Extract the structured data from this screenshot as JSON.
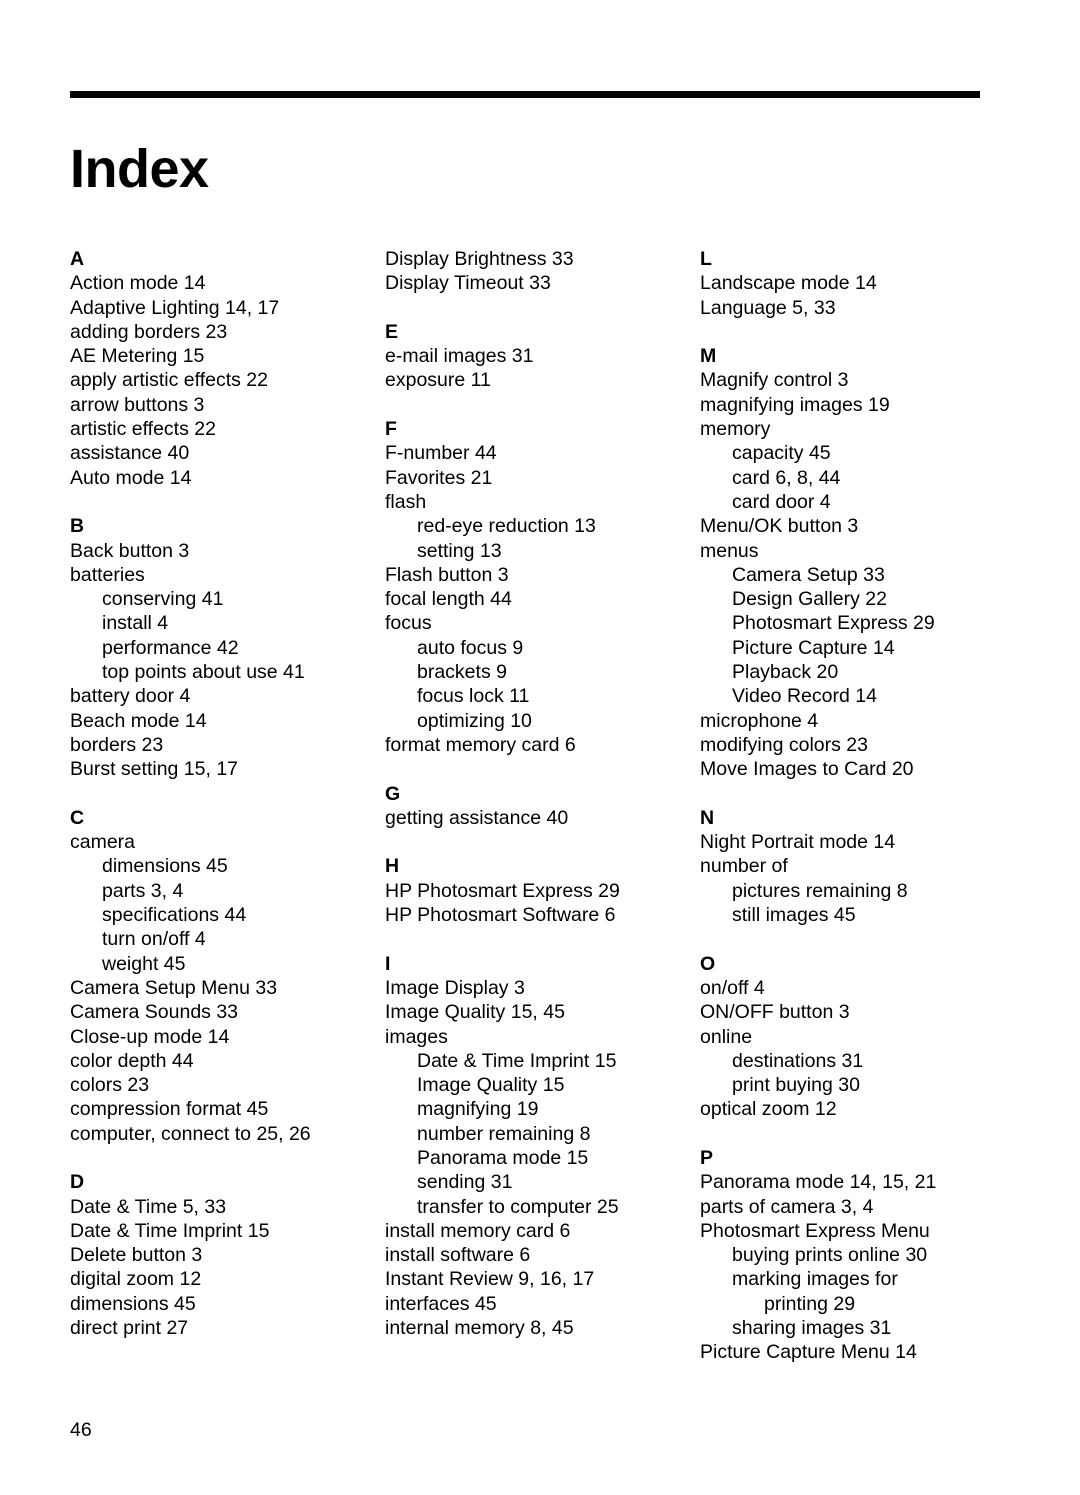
{
  "document": {
    "title": "Index",
    "page_number": "46"
  },
  "columns": [
    {
      "sections": [
        {
          "letter": "A",
          "entries": [
            {
              "text": "Action mode 14",
              "level": 0
            },
            {
              "text": "Adaptive Lighting 14, 17",
              "level": 0
            },
            {
              "text": "adding borders 23",
              "level": 0
            },
            {
              "text": "AE Metering 15",
              "level": 0
            },
            {
              "text": "apply artistic effects 22",
              "level": 0
            },
            {
              "text": "arrow buttons 3",
              "level": 0
            },
            {
              "text": "artistic effects 22",
              "level": 0
            },
            {
              "text": "assistance 40",
              "level": 0
            },
            {
              "text": "Auto mode 14",
              "level": 0
            }
          ]
        },
        {
          "letter": "B",
          "entries": [
            {
              "text": "Back button 3",
              "level": 0
            },
            {
              "text": "batteries",
              "level": 0
            },
            {
              "text": "conserving 41",
              "level": 1
            },
            {
              "text": "install 4",
              "level": 1
            },
            {
              "text": "performance 42",
              "level": 1
            },
            {
              "text": "top points about use 41",
              "level": 1
            },
            {
              "text": "battery door 4",
              "level": 0
            },
            {
              "text": "Beach mode 14",
              "level": 0
            },
            {
              "text": "borders 23",
              "level": 0
            },
            {
              "text": "Burst setting 15, 17",
              "level": 0
            }
          ]
        },
        {
          "letter": "C",
          "entries": [
            {
              "text": "camera",
              "level": 0
            },
            {
              "text": "dimensions 45",
              "level": 1
            },
            {
              "text": "parts 3, 4",
              "level": 1
            },
            {
              "text": "specifications 44",
              "level": 1
            },
            {
              "text": "turn on/off 4",
              "level": 1
            },
            {
              "text": "weight 45",
              "level": 1
            },
            {
              "text": "Camera Setup Menu 33",
              "level": 0
            },
            {
              "text": "Camera Sounds 33",
              "level": 0
            },
            {
              "text": "Close-up mode 14",
              "level": 0
            },
            {
              "text": "color depth 44",
              "level": 0
            },
            {
              "text": "colors 23",
              "level": 0
            },
            {
              "text": "compression format 45",
              "level": 0
            },
            {
              "text": "computer, connect to 25, 26",
              "level": 0
            }
          ]
        },
        {
          "letter": "D",
          "entries": [
            {
              "text": "Date & Time 5, 33",
              "level": 0
            },
            {
              "text": "Date & Time Imprint 15",
              "level": 0
            },
            {
              "text": "Delete button 3",
              "level": 0
            },
            {
              "text": "digital zoom 12",
              "level": 0
            },
            {
              "text": "dimensions 45",
              "level": 0
            },
            {
              "text": "direct print 27",
              "level": 0
            }
          ]
        }
      ]
    },
    {
      "sections": [
        {
          "letter": "",
          "entries": [
            {
              "text": "Display Brightness 33",
              "level": 0
            },
            {
              "text": "Display Timeout 33",
              "level": 0
            }
          ]
        },
        {
          "letter": "E",
          "entries": [
            {
              "text": "e-mail images 31",
              "level": 0
            },
            {
              "text": "exposure 11",
              "level": 0
            }
          ]
        },
        {
          "letter": "F",
          "entries": [
            {
              "text": "F-number 44",
              "level": 0
            },
            {
              "text": "Favorites 21",
              "level": 0
            },
            {
              "text": "flash",
              "level": 0
            },
            {
              "text": "red-eye reduction 13",
              "level": 1
            },
            {
              "text": "setting 13",
              "level": 1
            },
            {
              "text": "Flash button 3",
              "level": 0
            },
            {
              "text": "focal length 44",
              "level": 0
            },
            {
              "text": "focus",
              "level": 0
            },
            {
              "text": "auto focus 9",
              "level": 1
            },
            {
              "text": "brackets 9",
              "level": 1
            },
            {
              "text": "focus lock 11",
              "level": 1
            },
            {
              "text": "optimizing 10",
              "level": 1
            },
            {
              "text": "format memory card 6",
              "level": 0
            }
          ]
        },
        {
          "letter": "G",
          "entries": [
            {
              "text": "getting assistance 40",
              "level": 0
            }
          ]
        },
        {
          "letter": "H",
          "entries": [
            {
              "text": "HP Photosmart Express 29",
              "level": 0
            },
            {
              "text": "HP Photosmart Software 6",
              "level": 0
            }
          ]
        },
        {
          "letter": "I",
          "entries": [
            {
              "text": "Image Display 3",
              "level": 0
            },
            {
              "text": "Image Quality 15, 45",
              "level": 0
            },
            {
              "text": "images",
              "level": 0
            },
            {
              "text": "Date & Time Imprint 15",
              "level": 1
            },
            {
              "text": "Image Quality 15",
              "level": 1
            },
            {
              "text": "magnifying 19",
              "level": 1
            },
            {
              "text": "number remaining 8",
              "level": 1
            },
            {
              "text": "Panorama mode 15",
              "level": 1
            },
            {
              "text": "sending 31",
              "level": 1
            },
            {
              "text": "transfer to computer 25",
              "level": 1
            },
            {
              "text": "install memory card 6",
              "level": 0
            },
            {
              "text": "install software 6",
              "level": 0
            },
            {
              "text": "Instant Review 9, 16, 17",
              "level": 0
            },
            {
              "text": "interfaces 45",
              "level": 0
            },
            {
              "text": "internal memory 8, 45",
              "level": 0
            }
          ]
        }
      ]
    },
    {
      "sections": [
        {
          "letter": "L",
          "entries": [
            {
              "text": "Landscape mode 14",
              "level": 0
            },
            {
              "text": "Language 5, 33",
              "level": 0
            }
          ]
        },
        {
          "letter": "M",
          "entries": [
            {
              "text": "Magnify control 3",
              "level": 0
            },
            {
              "text": "magnifying images 19",
              "level": 0
            },
            {
              "text": "memory",
              "level": 0
            },
            {
              "text": "capacity 45",
              "level": 1
            },
            {
              "text": "card 6, 8, 44",
              "level": 1
            },
            {
              "text": "card door 4",
              "level": 1
            },
            {
              "text": "Menu/OK button 3",
              "level": 0
            },
            {
              "text": "menus",
              "level": 0
            },
            {
              "text": "Camera Setup 33",
              "level": 1
            },
            {
              "text": "Design Gallery 22",
              "level": 1
            },
            {
              "text": "Photosmart Express 29",
              "level": 1
            },
            {
              "text": "Picture Capture 14",
              "level": 1
            },
            {
              "text": "Playback 20",
              "level": 1
            },
            {
              "text": "Video Record 14",
              "level": 1
            },
            {
              "text": "microphone 4",
              "level": 0
            },
            {
              "text": "modifying colors 23",
              "level": 0
            },
            {
              "text": "Move Images to Card 20",
              "level": 0
            }
          ]
        },
        {
          "letter": "N",
          "entries": [
            {
              "text": "Night Portrait mode 14",
              "level": 0
            },
            {
              "text": "number of",
              "level": 0
            },
            {
              "text": "pictures remaining 8",
              "level": 1
            },
            {
              "text": "still images 45",
              "level": 1
            }
          ]
        },
        {
          "letter": "O",
          "entries": [
            {
              "text": "on/off 4",
              "level": 0
            },
            {
              "text": "ON/OFF button 3",
              "level": 0
            },
            {
              "text": "online",
              "level": 0
            },
            {
              "text": "destinations 31",
              "level": 1
            },
            {
              "text": "print buying 30",
              "level": 1
            },
            {
              "text": "optical zoom 12",
              "level": 0
            }
          ]
        },
        {
          "letter": "P",
          "entries": [
            {
              "text": "Panorama mode 14, 15, 21",
              "level": 0
            },
            {
              "text": "parts of camera 3, 4",
              "level": 0
            },
            {
              "text": "Photosmart Express Menu",
              "level": 0
            },
            {
              "text": "buying prints online 30",
              "level": 1
            },
            {
              "text": "marking images for",
              "level": 1
            },
            {
              "text": "printing 29",
              "level": 2
            },
            {
              "text": "sharing images 31",
              "level": 1
            },
            {
              "text": "Picture Capture Menu 14",
              "level": 0
            }
          ]
        }
      ]
    }
  ]
}
